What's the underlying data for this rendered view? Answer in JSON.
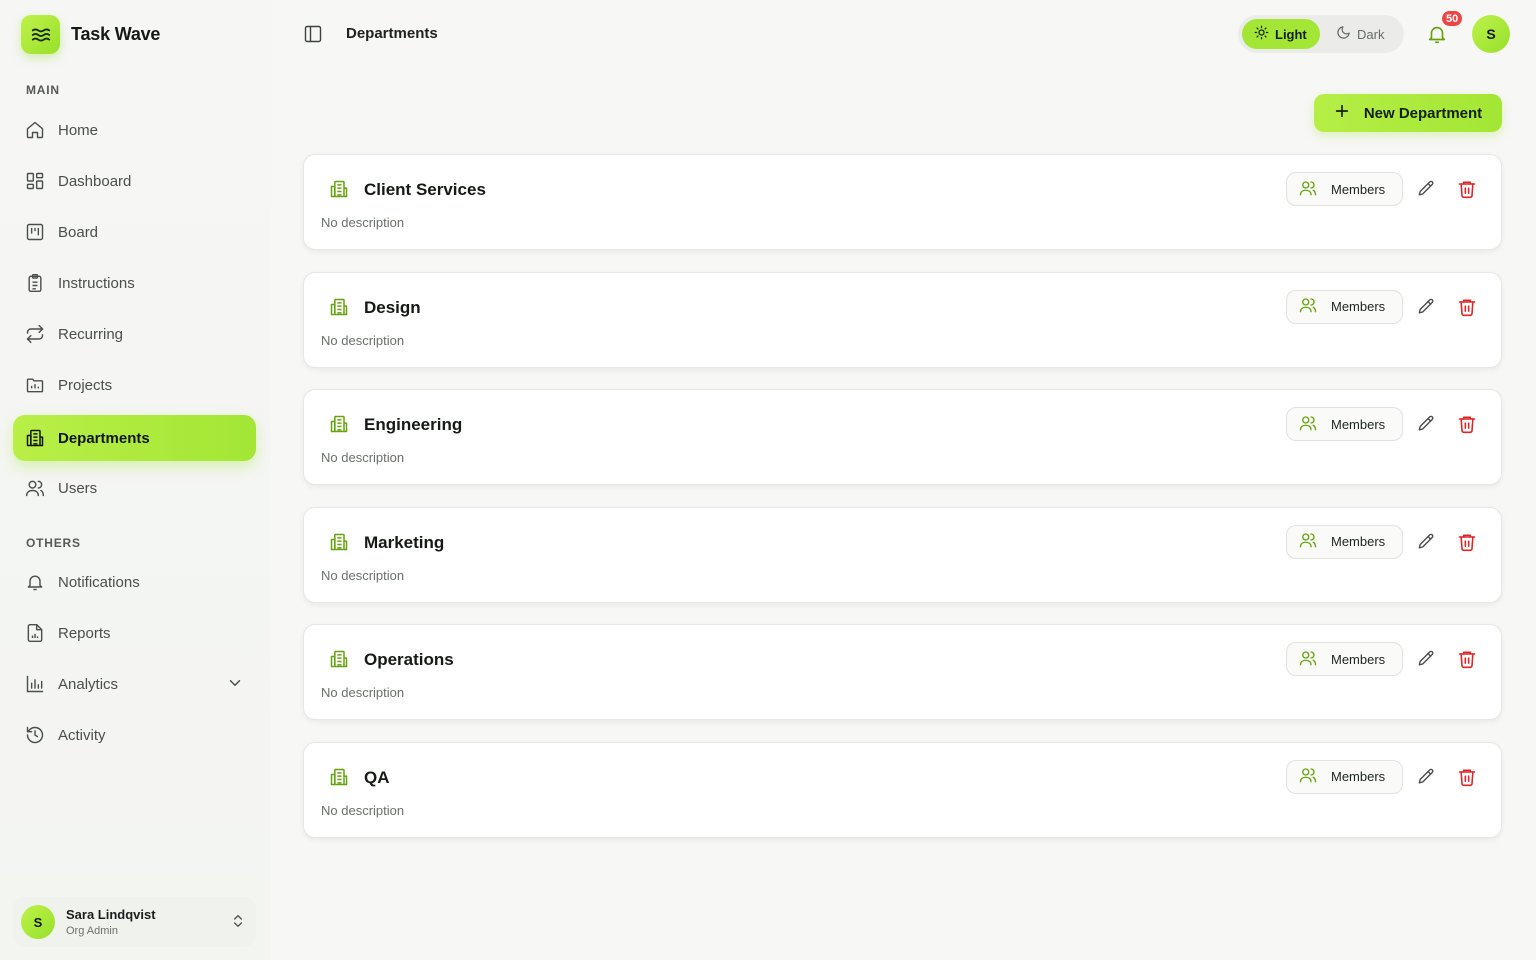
{
  "app": {
    "name": "Task Wave"
  },
  "sidebar": {
    "main_label": "MAIN",
    "others_label": "OTHERS",
    "main_items": [
      {
        "label": "Home",
        "icon": "home-icon"
      },
      {
        "label": "Dashboard",
        "icon": "dashboard-icon"
      },
      {
        "label": "Board",
        "icon": "board-icon"
      },
      {
        "label": "Instructions",
        "icon": "clipboard-icon"
      },
      {
        "label": "Recurring",
        "icon": "repeat-icon"
      },
      {
        "label": "Projects",
        "icon": "folder-icon"
      },
      {
        "label": "Departments",
        "icon": "building-icon",
        "active": true
      },
      {
        "label": "Users",
        "icon": "users-icon"
      }
    ],
    "other_items": [
      {
        "label": "Notifications",
        "icon": "bell-icon"
      },
      {
        "label": "Reports",
        "icon": "report-icon"
      },
      {
        "label": "Analytics",
        "icon": "bar-chart-icon",
        "expandable": true
      },
      {
        "label": "Activity",
        "icon": "history-icon"
      }
    ],
    "user": {
      "initial": "S",
      "name": "Sara Lindqvist",
      "role": "Org Admin"
    }
  },
  "header": {
    "title": "Departments",
    "theme": {
      "light_label": "Light",
      "dark_label": "Dark",
      "selected": "Light"
    },
    "notification_count": "50",
    "avatar_initial": "S"
  },
  "actions": {
    "new_department_label": "New Department"
  },
  "departments": [
    {
      "name": "Client Services",
      "description": "No description",
      "members_label": "Members"
    },
    {
      "name": "Design",
      "description": "No description",
      "members_label": "Members"
    },
    {
      "name": "Engineering",
      "description": "No description",
      "members_label": "Members"
    },
    {
      "name": "Marketing",
      "description": "No description",
      "members_label": "Members"
    },
    {
      "name": "Operations",
      "description": "No description",
      "members_label": "Members"
    },
    {
      "name": "QA",
      "description": "No description",
      "members_label": "Members"
    }
  ],
  "colors": {
    "accent": "#a3e635",
    "icon_green": "#65a30d",
    "danger": "#dc2626",
    "badge": "#ef4444"
  }
}
